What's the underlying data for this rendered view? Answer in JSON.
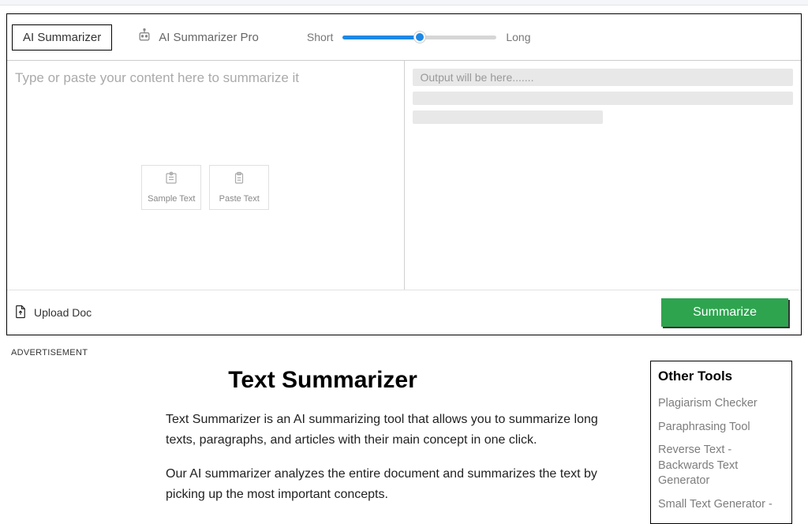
{
  "tabs": {
    "basic": "AI Summarizer",
    "pro": "AI Summarizer Pro"
  },
  "slider": {
    "shortLabel": "Short",
    "longLabel": "Long"
  },
  "left": {
    "placeholder": "Type or paste your content here to summarize it",
    "sampleText": "Sample Text",
    "pasteText": "Paste Text"
  },
  "right": {
    "placeholder": "Output will be here......."
  },
  "bottom": {
    "upload": "Upload Doc",
    "summarize": "Summarize"
  },
  "adLabel": "ADVERTISEMENT",
  "article": {
    "title": "Text Summarizer",
    "p1": "Text Summarizer is an AI summarizing tool that allows you to summarize long texts, paragraphs, and articles with their main concept in one click.",
    "p2": "Our AI summarizer analyzes the entire document and summarizes the text by picking up the most important concepts."
  },
  "sidebar": {
    "title": "Other Tools",
    "items": [
      "Plagiarism Checker",
      "Paraphrasing Tool",
      "Reverse Text - Backwards Text Generator",
      "Small Text Generator -"
    ]
  }
}
